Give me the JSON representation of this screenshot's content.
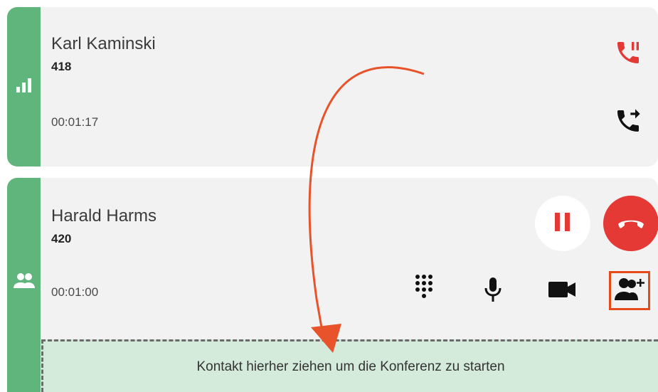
{
  "calls": [
    {
      "name": "Karl Kaminski",
      "extension": "418",
      "duration": "00:01:17",
      "strip_icon": "signal-bars-icon",
      "actions": [
        "phone-paused-icon",
        "phone-forward-icon"
      ]
    },
    {
      "name": "Harald Harms",
      "extension": "420",
      "duration": "00:01:00",
      "strip_icon": "group-icon",
      "actions": [
        "pause-icon",
        "hang-up-icon",
        "dialpad-icon",
        "microphone-icon",
        "video-camera-icon",
        "add-participant-icon"
      ]
    }
  ],
  "dropzone": {
    "label": "Kontakt hierher ziehen um die Konferenz zu starten"
  },
  "colors": {
    "strip_green": "#5fb57b",
    "card_bg": "#f2f2f2",
    "red": "#e53935",
    "highlight_orange": "#e64a19",
    "dropzone_bg": "#d4ebdc"
  }
}
